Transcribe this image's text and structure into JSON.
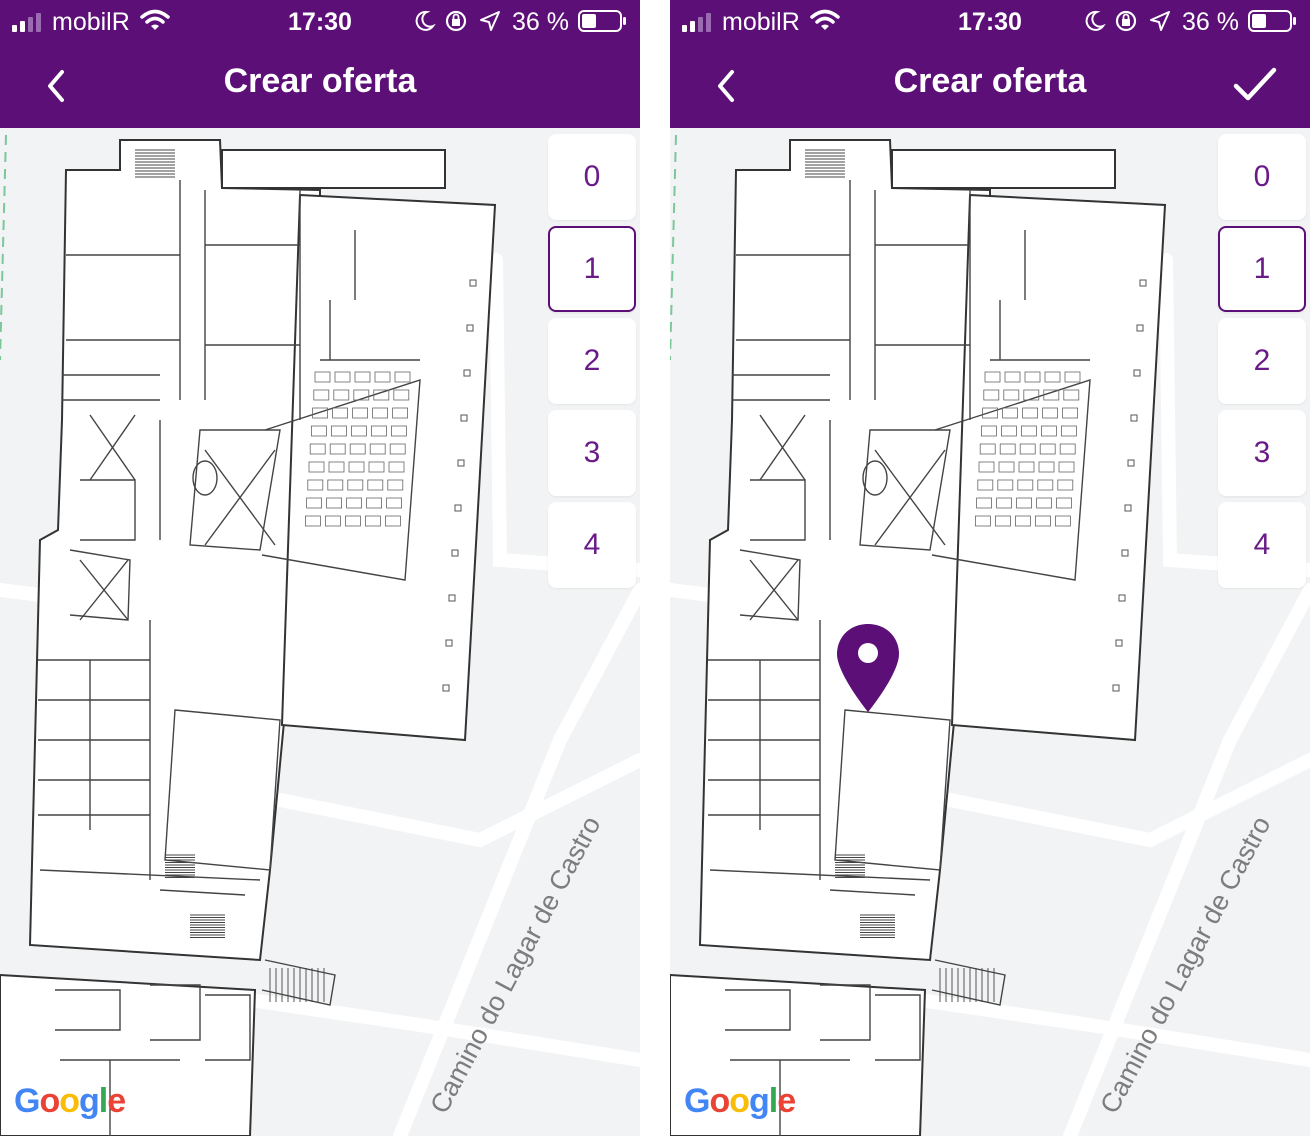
{
  "status_bar": {
    "carrier": "mobilR",
    "time": "17:30",
    "battery": "36 %"
  },
  "nav": {
    "title": "Crear oferta",
    "back_icon": "chevron-left-icon",
    "confirm_icon": "checkmark-icon"
  },
  "floors": [
    "0",
    "1",
    "2",
    "3",
    "4"
  ],
  "selected_floor": "1",
  "map": {
    "street": "Camino do Lagar de Castro",
    "logo": "Google"
  },
  "colors": {
    "brand": "#5c0f77",
    "floor_text": "#6a1b88",
    "map_bg": "#f1f3f4"
  }
}
